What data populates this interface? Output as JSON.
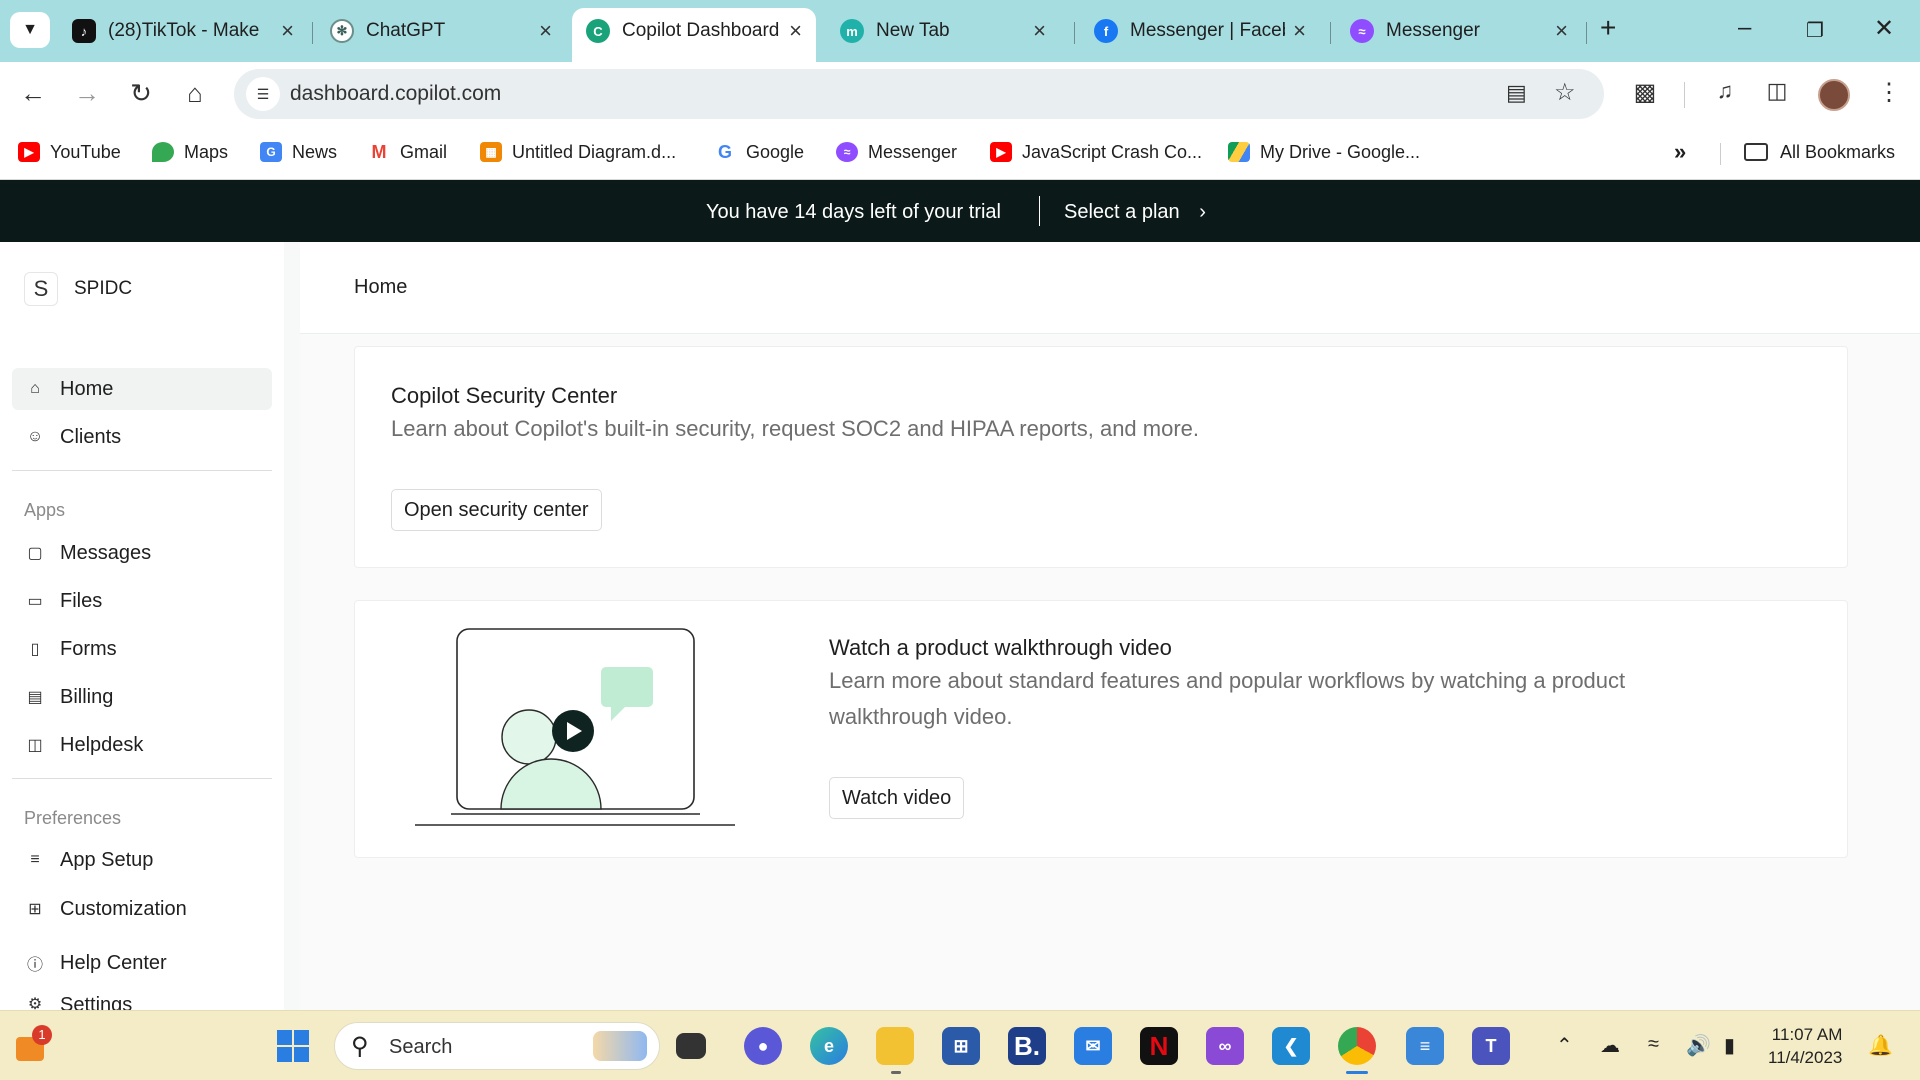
{
  "browser": {
    "tabs": [
      {
        "title": "(28)TikTok - Make",
        "icon": "tiktok-icon",
        "active": false
      },
      {
        "title": "ChatGPT",
        "icon": "chatgpt-icon",
        "active": false
      },
      {
        "title": "Copilot Dashboard",
        "icon": "copilot-icon",
        "active": true
      },
      {
        "title": "New Tab",
        "icon": "new-tab-icon",
        "active": false
      },
      {
        "title": "Messenger | Faceb",
        "icon": "facebook-icon",
        "active": false
      },
      {
        "title": "Messenger",
        "icon": "messenger-icon",
        "active": false
      }
    ],
    "url": "dashboard.copilot.com",
    "bookmarks": [
      {
        "label": "YouTube",
        "icon": "youtube-icon"
      },
      {
        "label": "Maps",
        "icon": "maps-icon"
      },
      {
        "label": "News",
        "icon": "news-icon"
      },
      {
        "label": "Gmail",
        "icon": "gmail-icon"
      },
      {
        "label": "Untitled Diagram.d...",
        "icon": "drawio-icon"
      },
      {
        "label": "Google",
        "icon": "google-icon"
      },
      {
        "label": "Messenger",
        "icon": "messenger-icon"
      },
      {
        "label": "JavaScript Crash Co...",
        "icon": "youtube-icon"
      },
      {
        "label": "My Drive - Google...",
        "icon": "drive-icon"
      }
    ],
    "all_bookmarks": "All Bookmarks"
  },
  "trial_banner": {
    "message": "You have 14 days left of your trial",
    "cta": "Select a plan"
  },
  "sidebar": {
    "org_initial": "S",
    "org_name": "SPIDC",
    "main_items": [
      {
        "label": "Home",
        "icon": "home-icon",
        "active": true
      },
      {
        "label": "Clients",
        "icon": "clients-icon",
        "active": false
      }
    ],
    "apps_heading": "Apps",
    "apps": [
      {
        "label": "Messages",
        "icon": "messages-icon"
      },
      {
        "label": "Files",
        "icon": "folder-icon"
      },
      {
        "label": "Forms",
        "icon": "clipboard-icon"
      },
      {
        "label": "Billing",
        "icon": "credit-card-icon"
      },
      {
        "label": "Helpdesk",
        "icon": "book-icon"
      }
    ],
    "preferences_heading": "Preferences",
    "preferences": [
      {
        "label": "App Setup",
        "icon": "sliders-icon"
      },
      {
        "label": "Customization",
        "icon": "grid-icon"
      },
      {
        "label": "Help Center",
        "icon": "help-icon"
      },
      {
        "label": "Settings",
        "icon": "gear-icon"
      }
    ]
  },
  "page": {
    "breadcrumb": "Home",
    "security_card": {
      "title": "Copilot Security Center",
      "description": "Learn about Copilot's built-in security, request SOC2 and HIPAA reports, and more.",
      "button": "Open security center"
    },
    "video_card": {
      "title": "Watch a product walkthrough video",
      "description": "Learn more about standard features and popular workflows by watching a product walkthrough video.",
      "button": "Watch video"
    }
  },
  "taskbar": {
    "search_label": "Search",
    "notification_badge": "1",
    "time": "11:07 AM",
    "date": "11/4/2023"
  },
  "colors": {
    "tab_strip": "#a6dde0",
    "trial_banner": "#0b1a18",
    "illustration_green": "#bfecd2",
    "taskbar": "#f4ecc6"
  }
}
